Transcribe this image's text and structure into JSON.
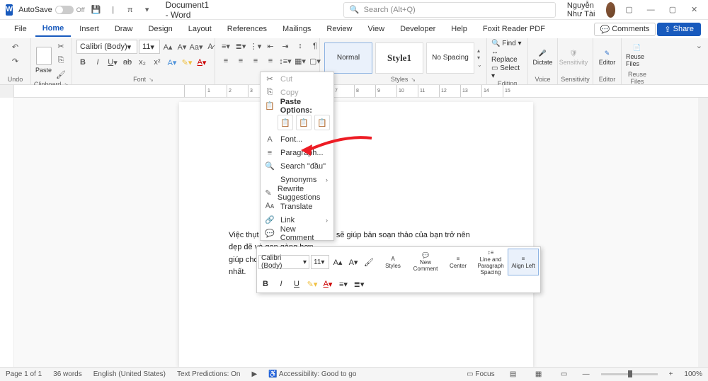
{
  "titlebar": {
    "autosave_label": "AutoSave",
    "autosave_state": "Off",
    "doc_title": "Document1 - Word",
    "search_placeholder": "Search (Alt+Q)",
    "user_name": "Nguyễn Như Tài"
  },
  "tabs": {
    "items": [
      "File",
      "Home",
      "Insert",
      "Draw",
      "Design",
      "Layout",
      "References",
      "Mailings",
      "Review",
      "View",
      "Developer",
      "Help",
      "Foxit Reader PDF"
    ],
    "comments": "Comments",
    "share": "Share"
  },
  "ribbon": {
    "undo_label": "Undo",
    "clipboard_label": "Clipboard",
    "paste_label": "Paste",
    "font_label": "Font",
    "font_name": "Calibri (Body)",
    "font_size": "11",
    "paragraph_label": "P",
    "styles_label": "Styles",
    "style_normal": "Normal",
    "style_1": "Style1",
    "style_nospacing": "No Spacing",
    "editing_label": "Editing",
    "find": "Find",
    "replace": "Replace",
    "select": "Select",
    "voice_label": "Voice",
    "dictate": "Dictate",
    "sensitivity_label": "Sensitivity",
    "sensitivity": "Sensitivity",
    "editor_label": "Editor",
    "editor": "Editor",
    "reuse_label": "Reuse Files",
    "reuse": "Reuse Files"
  },
  "context_menu": {
    "cut": "Cut",
    "copy": "Copy",
    "paste_header": "Paste Options:",
    "font": "Font...",
    "paragraph": "Paragraph...",
    "search": "Search \"đầu\"",
    "synonyms": "Synonyms",
    "rewrite": "Rewrite Suggestions",
    "translate": "Translate",
    "link": "Link",
    "new_comment": "New Comment"
  },
  "mini_toolbar": {
    "font_name": "Calibri (Body)",
    "font_size": "11",
    "styles": "Styles",
    "new_comment": "New Comment",
    "center": "Center",
    "line_spacing": "Line and Paragraph Spacing",
    "align_left": "Align Left"
  },
  "document": {
    "line1": "Việc thụt đầu dòng trong Word sẽ giúp bản soạn thảo của bạn trở nên đẹp đẽ và gọn gàng hơn",
    "line2": "giúp cho người xem có thể đọc được các thông tin một cách dễ dàng nhất."
  },
  "status": {
    "page": "Page 1 of 1",
    "words": "36 words",
    "language": "English (United States)",
    "predictions": "Text Predictions: On",
    "accessibility": "Accessibility: Good to go",
    "focus": "Focus",
    "zoom": "100%"
  }
}
